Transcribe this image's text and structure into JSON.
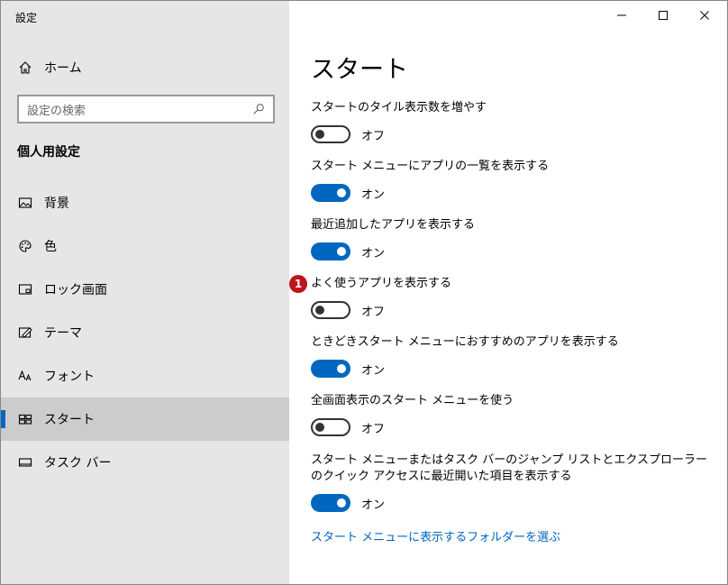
{
  "window": {
    "title": "設定",
    "controls": {
      "minimize": "minimize-icon",
      "maximize": "maximize-icon",
      "close": "close-icon"
    }
  },
  "sidebar": {
    "home_label": "ホーム",
    "search_placeholder": "設定の検索",
    "section_title": "個人用設定",
    "items": [
      {
        "label": "背景",
        "icon": "picture-icon",
        "selected": false
      },
      {
        "label": "色",
        "icon": "palette-icon",
        "selected": false
      },
      {
        "label": "ロック画面",
        "icon": "lock-screen-icon",
        "selected": false
      },
      {
        "label": "テーマ",
        "icon": "theme-icon",
        "selected": false
      },
      {
        "label": "フォント",
        "icon": "font-icon",
        "selected": false
      },
      {
        "label": "スタート",
        "icon": "start-icon",
        "selected": true
      },
      {
        "label": "タスク バー",
        "icon": "taskbar-icon",
        "selected": false
      }
    ]
  },
  "main": {
    "title": "スタート",
    "settings": [
      {
        "label": "スタートのタイル表示数を増やす",
        "state": "オフ",
        "on": false
      },
      {
        "label": "スタート メニューにアプリの一覧を表示する",
        "state": "オン",
        "on": true
      },
      {
        "label": "最近追加したアプリを表示する",
        "state": "オン",
        "on": true
      },
      {
        "label": "よく使うアプリを表示する",
        "state": "オフ",
        "on": false
      },
      {
        "label": "ときどきスタート メニューにおすすめのアプリを表示する",
        "state": "オン",
        "on": true
      },
      {
        "label": "全画面表示のスタート メニューを使う",
        "state": "オフ",
        "on": false
      },
      {
        "label": "スタート メニューまたはタスク バーのジャンプ リストとエクスプローラーのクイック アクセスに最近開いた項目を表示する",
        "state": "オン",
        "on": true
      }
    ],
    "link": "スタート メニューに表示するフォルダーを選ぶ",
    "badge": "1"
  },
  "colors": {
    "accent": "#0067c0",
    "sidebar_bg": "#e6e6e6",
    "selected_bg": "#cccccc",
    "badge": "#c0141c"
  }
}
